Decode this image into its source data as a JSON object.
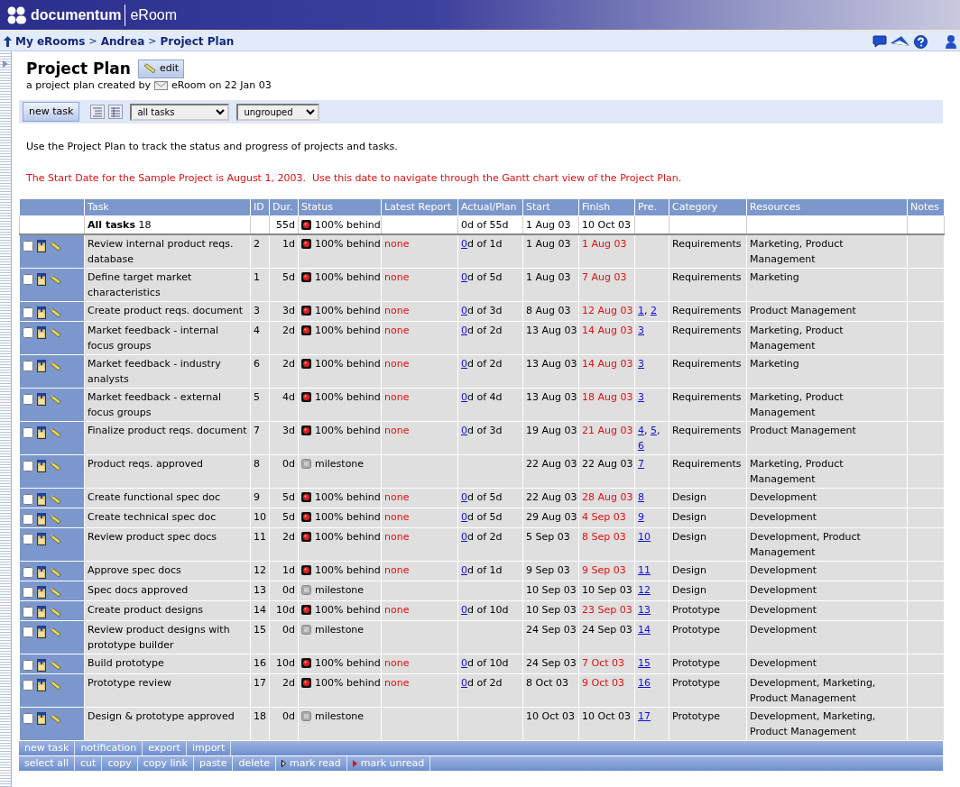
{
  "header": {
    "brand": "documentum",
    "product": "eRoom"
  },
  "breadcrumb": {
    "separator": ">",
    "items": [
      "My eRooms",
      "Andrea",
      "Project Plan"
    ]
  },
  "page": {
    "title": "Project Plan",
    "edit_button": "edit",
    "subtitle": "a project plan created by",
    "author_line": "eRoom on 22 Jan 03"
  },
  "toolbar": {
    "new_task": "new task",
    "filter": "all tasks",
    "grouping": "ungrouped"
  },
  "intro": "Use the Project Plan to track the status and progress of projects and tasks.",
  "notice": "The Start Date for the Sample Project is August 1, 2003.  Use this date to navigate through the Gantt chart view of the Project Plan.",
  "table": {
    "pre_separator": ",",
    "columns": [
      "Task",
      "ID",
      "Dur.",
      "Status",
      "Latest Report",
      "Actual/Plan",
      "Start",
      "Finish",
      "Pre.",
      "Category",
      "Resources",
      "Notes"
    ],
    "summary": {
      "task": "**All tasks** 18",
      "dur": "55d",
      "status": {
        "kind": "behind",
        "text": "100% behind"
      },
      "actual": "0d of 55d",
      "start": "1 Aug 03",
      "finish": "10 Oct 03"
    },
    "rows": [
      {
        "checked": false,
        "task": "Review internal product reqs. database",
        "id": "2",
        "dur": "1d",
        "status": {
          "kind": "behind",
          "text": "100% behind"
        },
        "report": "none",
        "actual_done": "0",
        "actual_rest": "d of 1d",
        "start": "1 Aug 03",
        "finish": "1 Aug 03",
        "late": true,
        "pre": [],
        "category": "Requirements",
        "resources": "Marketing, Product Management"
      },
      {
        "checked": false,
        "task": "Define target market characteristics",
        "id": "1",
        "dur": "5d",
        "status": {
          "kind": "behind",
          "text": "100% behind"
        },
        "report": "none",
        "actual_done": "0",
        "actual_rest": "d of 5d",
        "start": "1 Aug 03",
        "finish": "7 Aug 03",
        "late": true,
        "pre": [],
        "category": "Requirements",
        "resources": "Marketing"
      },
      {
        "checked": false,
        "task": "Create product reqs. document",
        "id": "3",
        "dur": "3d",
        "status": {
          "kind": "behind",
          "text": "100% behind"
        },
        "report": "none",
        "actual_done": "0",
        "actual_rest": "d of 3d",
        "start": "8 Aug 03",
        "finish": "12 Aug 03",
        "late": true,
        "pre": [
          "1",
          "2"
        ],
        "category": "Requirements",
        "resources": "Product Management"
      },
      {
        "checked": false,
        "task": "Market feedback - internal focus groups",
        "id": "4",
        "dur": "2d",
        "status": {
          "kind": "behind",
          "text": "100% behind"
        },
        "report": "none",
        "actual_done": "0",
        "actual_rest": "d of 2d",
        "start": "13 Aug 03",
        "finish": "14 Aug 03",
        "late": true,
        "pre": [
          "3"
        ],
        "category": "Requirements",
        "resources": "Marketing, Product Management"
      },
      {
        "checked": false,
        "task": "Market feedback - industry analysts",
        "id": "6",
        "dur": "2d",
        "status": {
          "kind": "behind",
          "text": "100% behind"
        },
        "report": "none",
        "actual_done": "0",
        "actual_rest": "d of 2d",
        "start": "13 Aug 03",
        "finish": "14 Aug 03",
        "late": true,
        "pre": [
          "3"
        ],
        "category": "Requirements",
        "resources": "Marketing"
      },
      {
        "checked": false,
        "task": "Market feedback - external focus groups",
        "id": "5",
        "dur": "4d",
        "status": {
          "kind": "behind",
          "text": "100% behind"
        },
        "report": "none",
        "actual_done": "0",
        "actual_rest": "d of 4d",
        "start": "13 Aug 03",
        "finish": "18 Aug 03",
        "late": true,
        "pre": [
          "3"
        ],
        "category": "Requirements",
        "resources": "Marketing, Product Management"
      },
      {
        "checked": false,
        "task": "Finalize product reqs. document",
        "id": "7",
        "dur": "3d",
        "status": {
          "kind": "behind",
          "text": "100% behind"
        },
        "report": "none",
        "actual_done": "0",
        "actual_rest": "d of 3d",
        "start": "19 Aug 03",
        "finish": "21 Aug 03",
        "late": true,
        "pre": [
          "4",
          "5",
          "6"
        ],
        "category": "Requirements",
        "resources": "Product Management"
      },
      {
        "checked": false,
        "task": "Product reqs. approved",
        "id": "8",
        "dur": "0d",
        "status": {
          "kind": "milestone",
          "text": "milestone"
        },
        "start": "22 Aug 03",
        "finish": "22 Aug 03",
        "late": false,
        "pre": [
          "7"
        ],
        "category": "Requirements",
        "resources": "Marketing, Product Management"
      },
      {
        "checked": false,
        "task": "Create functional spec doc",
        "id": "9",
        "dur": "5d",
        "status": {
          "kind": "behind",
          "text": "100% behind"
        },
        "report": "none",
        "actual_done": "0",
        "actual_rest": "d of 5d",
        "start": "22 Aug 03",
        "finish": "28 Aug 03",
        "late": true,
        "pre": [
          "8"
        ],
        "category": "Design",
        "resources": "Development"
      },
      {
        "checked": false,
        "task": "Create technical spec doc",
        "id": "10",
        "dur": "5d",
        "status": {
          "kind": "behind",
          "text": "100% behind"
        },
        "report": "none",
        "actual_done": "0",
        "actual_rest": "d of 5d",
        "start": "29 Aug 03",
        "finish": "4 Sep 03",
        "late": true,
        "pre": [
          "9"
        ],
        "category": "Design",
        "resources": "Development"
      },
      {
        "checked": false,
        "task": "Review product spec docs",
        "id": "11",
        "dur": "2d",
        "status": {
          "kind": "behind",
          "text": "100% behind"
        },
        "report": "none",
        "actual_done": "0",
        "actual_rest": "d of 2d",
        "start": "5 Sep 03",
        "finish": "8 Sep 03",
        "late": true,
        "pre": [
          "10"
        ],
        "category": "Design",
        "resources": "Development, Product Management"
      },
      {
        "checked": false,
        "task": "Approve spec docs",
        "id": "12",
        "dur": "1d",
        "status": {
          "kind": "behind",
          "text": "100% behind"
        },
        "report": "none",
        "actual_done": "0",
        "actual_rest": "d of 1d",
        "start": "9 Sep 03",
        "finish": "9 Sep 03",
        "late": true,
        "pre": [
          "11"
        ],
        "category": "Design",
        "resources": "Development"
      },
      {
        "checked": false,
        "task": "Spec docs approved",
        "id": "13",
        "dur": "0d",
        "status": {
          "kind": "milestone",
          "text": "milestone"
        },
        "start": "10 Sep 03",
        "finish": "10 Sep 03",
        "late": false,
        "pre": [
          "12"
        ],
        "category": "Design",
        "resources": "Development"
      },
      {
        "checked": false,
        "task": "Create product designs",
        "id": "14",
        "dur": "10d",
        "status": {
          "kind": "behind",
          "text": "100% behind"
        },
        "report": "none",
        "actual_done": "0",
        "actual_rest": "d of 10d",
        "start": "10 Sep 03",
        "finish": "23 Sep 03",
        "late": true,
        "pre": [
          "13"
        ],
        "category": "Prototype",
        "resources": "Development"
      },
      {
        "checked": false,
        "task": "Review product designs with prototype builder",
        "id": "15",
        "dur": "0d",
        "status": {
          "kind": "milestone",
          "text": "milestone"
        },
        "start": "24 Sep 03",
        "finish": "24 Sep 03",
        "late": false,
        "pre": [
          "14"
        ],
        "category": "Prototype",
        "resources": "Development"
      },
      {
        "checked": false,
        "task": "Build prototype",
        "id": "16",
        "dur": "10d",
        "status": {
          "kind": "behind",
          "text": "100% behind"
        },
        "report": "none",
        "actual_done": "0",
        "actual_rest": "d of 10d",
        "start": "24 Sep 03",
        "finish": "7 Oct 03",
        "late": true,
        "pre": [
          "15"
        ],
        "category": "Prototype",
        "resources": "Development"
      },
      {
        "checked": false,
        "task": "Prototype review",
        "id": "17",
        "dur": "2d",
        "status": {
          "kind": "behind",
          "text": "100% behind"
        },
        "report": "none",
        "actual_done": "0",
        "actual_rest": "d of 2d",
        "start": "8 Oct 03",
        "finish": "9 Oct 03",
        "late": true,
        "pre": [
          "16"
        ],
        "category": "Prototype",
        "resources": "Development, Marketing, Product Management"
      },
      {
        "checked": false,
        "task": "Design & prototype approved",
        "id": "18",
        "dur": "0d",
        "status": {
          "kind": "milestone",
          "text": "milestone"
        },
        "start": "10 Oct 03",
        "finish": "10 Oct 03",
        "late": false,
        "pre": [
          "17"
        ],
        "category": "Prototype",
        "resources": "Development, Marketing, Product Management"
      }
    ]
  },
  "footer": {
    "actions": [
      {
        "label": "new task",
        "kind": "plain"
      },
      {
        "label": "notification",
        "kind": "plain"
      },
      {
        "label": "export",
        "kind": "plain"
      },
      {
        "label": "import",
        "kind": "plain"
      }
    ],
    "selection_actions": [
      {
        "label": "select all",
        "kind": "plain"
      },
      {
        "label": "cut",
        "kind": "plain"
      },
      {
        "label": "copy",
        "kind": "plain"
      },
      {
        "label": "copy link",
        "kind": "plain"
      },
      {
        "label": "paste",
        "kind": "plain"
      },
      {
        "label": "delete",
        "kind": "plain"
      },
      {
        "label": "mark read",
        "kind": "read"
      },
      {
        "label": "mark unread",
        "kind": "unread"
      }
    ]
  }
}
